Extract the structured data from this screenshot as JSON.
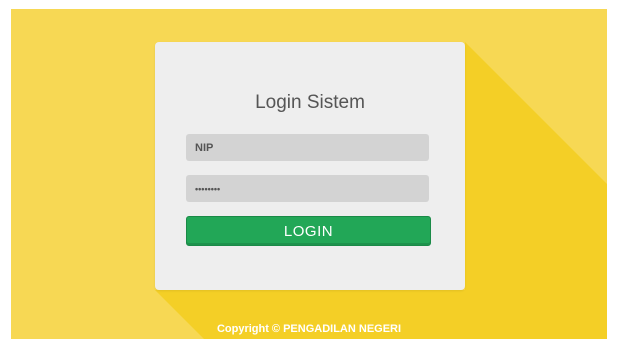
{
  "login": {
    "title": "Login Sistem",
    "nip_placeholder": "NIP",
    "password_value": "••••••••",
    "button_label": "LOGIN"
  },
  "footer": {
    "copyright": "Copyright © PENGADILAN NEGERI"
  },
  "colors": {
    "background": "#f7d854",
    "shadow": "#f4cf26",
    "card": "#eeeeee",
    "input": "#d3d3d3",
    "button": "#22a757"
  }
}
